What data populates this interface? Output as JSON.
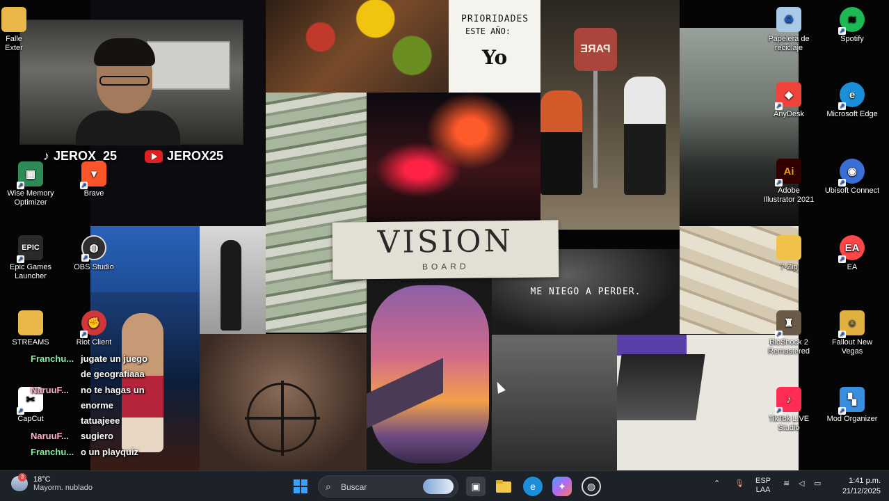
{
  "collage": {
    "prioridades_line1": "PRIORIDADES",
    "prioridades_line2": "ESTE AÑO:",
    "prioridades_answer": "Yo",
    "stop_sign": "PARE",
    "vision_title": "VISION",
    "vision_subtitle": "BOARD",
    "motto": "ME NIEGO A PERDER."
  },
  "stream_overlay": {
    "tiktok_handle": "JEROX_25",
    "youtube_handle": "JEROX25"
  },
  "desktop_icons_left": [
    {
      "label": "Falle Exter",
      "icon": "folder-icon",
      "color": "#e8b84a"
    },
    {
      "label": "Wise Memory Optimizer",
      "icon": "memory-chip-icon",
      "color": "#2e8b57"
    },
    {
      "label": "Brave",
      "icon": "brave-lion-icon",
      "color": "#fb542b"
    },
    {
      "label": "Epic Games Launcher",
      "icon": "epic-games-icon",
      "color": "#2a2a2a"
    },
    {
      "label": "OBS Studio",
      "icon": "obs-icon",
      "color": "#302e31"
    },
    {
      "label": "STREAMS",
      "icon": "folder-icon",
      "color": "#e8b84a"
    },
    {
      "label": "Riot Client",
      "icon": "riot-fist-icon",
      "color": "#d13639"
    },
    {
      "label": "CapCut",
      "icon": "capcut-icon",
      "color": "#ffffff"
    }
  ],
  "desktop_icons_right": [
    {
      "label": "Papelera de reciclaje",
      "icon": "recycle-bin-icon",
      "color": "#a9c9e8"
    },
    {
      "label": "Spotify",
      "icon": "spotify-icon",
      "color": "#1db954"
    },
    {
      "label": "AnyDesk",
      "icon": "anydesk-icon",
      "color": "#ef443b"
    },
    {
      "label": "Microsoft Edge",
      "icon": "edge-icon",
      "color": "#1b8fd9"
    },
    {
      "label": "Adobe Illustrator 2021",
      "icon": "illustrator-icon",
      "color": "#330000"
    },
    {
      "label": "Ubisoft Connect",
      "icon": "ubisoft-icon",
      "color": "#3a6fd8"
    },
    {
      "label": "7-Zip",
      "icon": "folder-icon",
      "color": "#f0c24a"
    },
    {
      "label": "EA",
      "icon": "ea-icon",
      "color": "#ff4747"
    },
    {
      "label": "BioShock 2 Remastered",
      "icon": "bioshock-icon",
      "color": "#6a5a48"
    },
    {
      "label": "Fallout New Vegas",
      "icon": "vault-boy-icon",
      "color": "#e0b040"
    },
    {
      "label": "TikTok LIVE Studio",
      "icon": "tiktok-live-icon",
      "color": "#ff2d55"
    },
    {
      "label": "Mod Organizer",
      "icon": "mod-organizer-icon",
      "color": "#3a8ee0"
    }
  ],
  "chat": [
    {
      "user": "Franchu...",
      "message": "jugate un juego",
      "user_color": "#7ff0a0"
    },
    {
      "user": "",
      "message": "de geografiaaa",
      "user_color": "#7ff0a0"
    },
    {
      "user": "NaruuF...",
      "message": "no te hagas un",
      "user_color": "#ffb0d0"
    },
    {
      "user": "",
      "message": "enorme",
      "user_color": "#ffb0d0"
    },
    {
      "user": "",
      "message": "tatuajeee",
      "user_color": "#ffb0d0"
    },
    {
      "user": "NaruuF...",
      "message": "sugiero",
      "user_color": "#ffb0d0"
    },
    {
      "user": "Franchu...",
      "message": "o un playquiz",
      "user_color": "#7ff0a0"
    }
  ],
  "taskbar": {
    "weather_temp": "18°C",
    "weather_desc": "Mayorm. nublado",
    "weather_badge": "3",
    "search_placeholder": "Buscar",
    "lang_line1": "ESP",
    "lang_line2": "LAA",
    "time": "1:41 p.m.",
    "date": "21/12/2025",
    "pinned": [
      {
        "name": "start-icon",
        "color": "#3aa0ff"
      },
      {
        "name": "task-view-icon",
        "color": "#c8c8c8"
      },
      {
        "name": "file-explorer-icon",
        "color": "#f2c84b"
      },
      {
        "name": "edge-icon",
        "color": "#1b8fd9"
      },
      {
        "name": "copilot-icon",
        "color": "#b06af0"
      },
      {
        "name": "obs-icon",
        "color": "#dddddd"
      }
    ]
  }
}
